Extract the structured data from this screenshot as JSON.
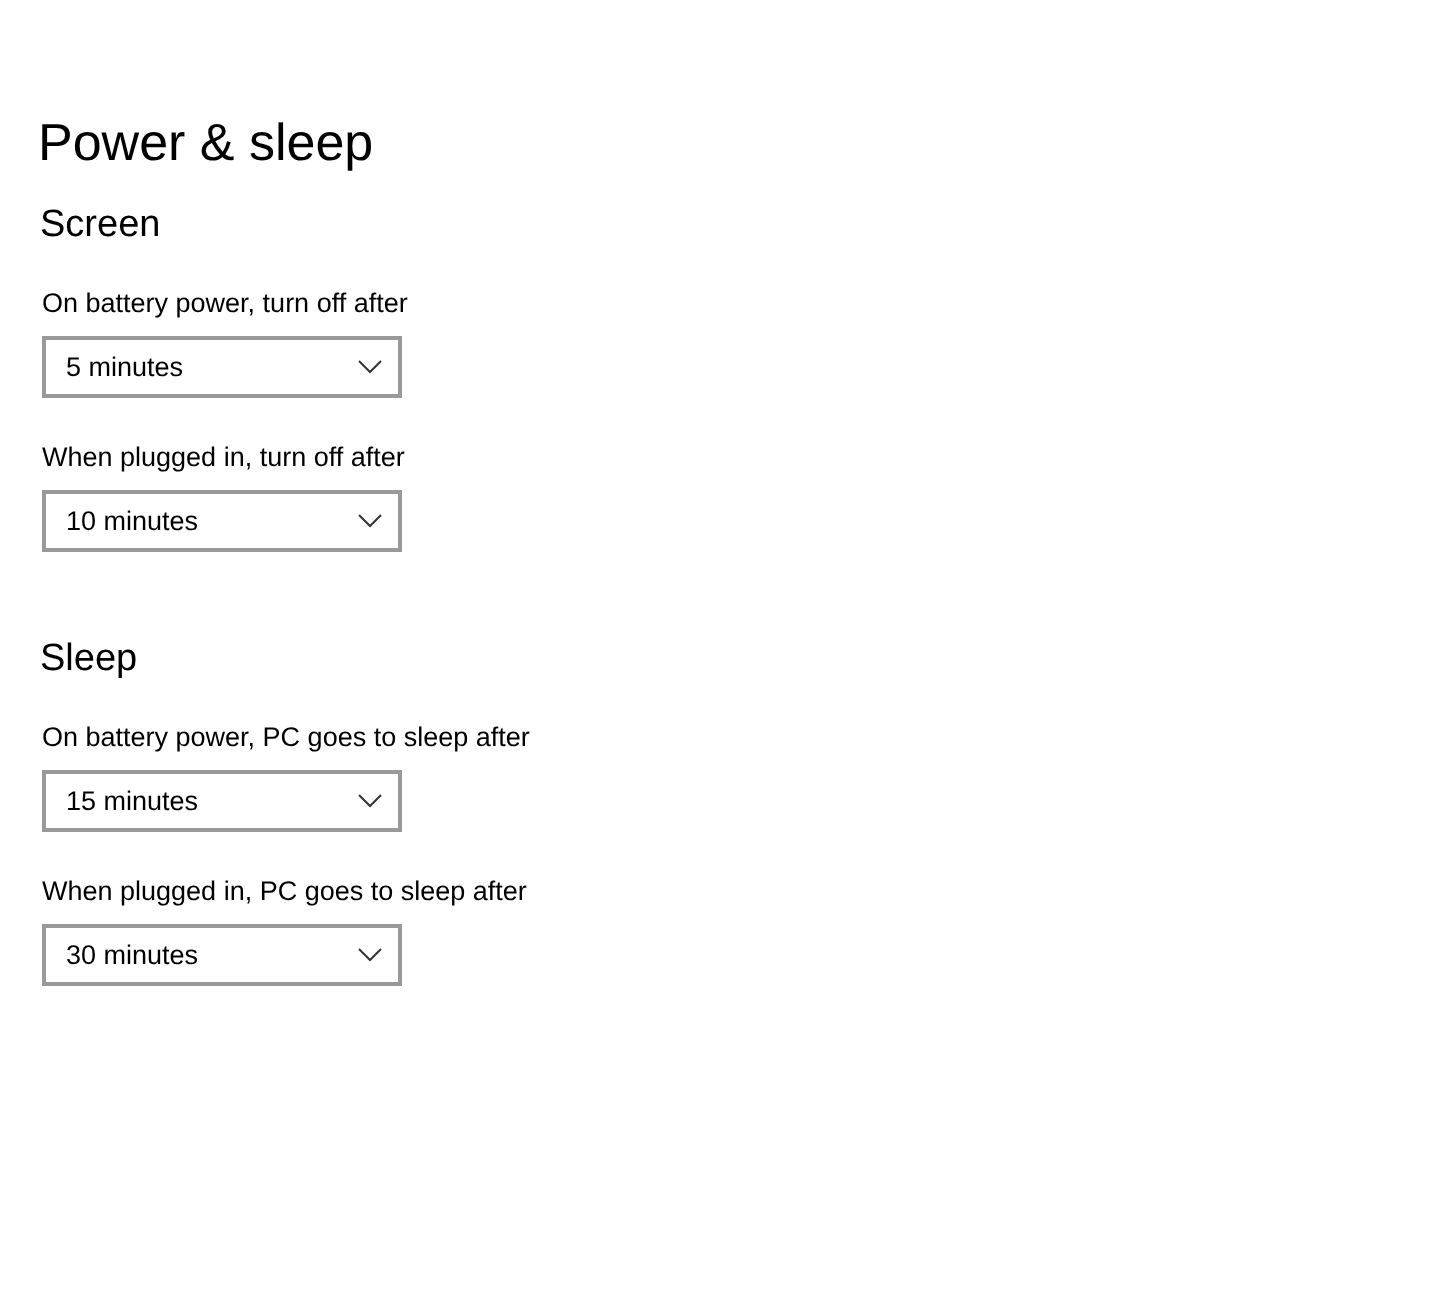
{
  "title": "Power & sleep",
  "sections": [
    {
      "heading": "Screen",
      "settings": [
        {
          "label": "On battery power, turn off after",
          "value": "5 minutes"
        },
        {
          "label": "When plugged in, turn off after",
          "value": "10 minutes"
        }
      ]
    },
    {
      "heading": "Sleep",
      "settings": [
        {
          "label": "On battery power, PC goes to sleep after",
          "value": "15 minutes"
        },
        {
          "label": "When plugged in, PC goes to sleep after",
          "value": "30 minutes"
        }
      ]
    }
  ]
}
